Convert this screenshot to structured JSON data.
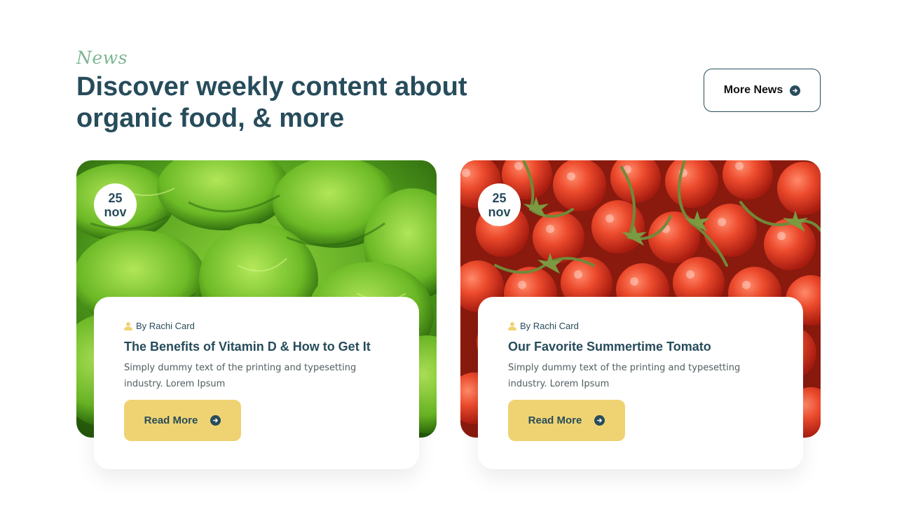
{
  "section": {
    "eyebrow": "News",
    "headline": "Discover weekly content about organic food, & more",
    "more_button": "More News"
  },
  "colors": {
    "primary": "#274c5b",
    "accent_green": "#7eb693",
    "button_yellow": "#efd372"
  },
  "cards": [
    {
      "date_day": "25",
      "date_month": "nov",
      "author": "By Rachi Card",
      "title": "The Benefits of Vitamin D & How to Get It",
      "excerpt": "Simply dummy text of the printing and typesetting industry. Lorem Ipsum",
      "button": "Read More",
      "image": "lettuce-photo"
    },
    {
      "date_day": "25",
      "date_month": "nov",
      "author": "By Rachi Card",
      "title": "Our Favorite Summertime Tomato",
      "excerpt": "Simply dummy text of the printing and typesetting industry. Lorem Ipsum",
      "button": "Read More",
      "image": "tomatoes-photo"
    }
  ],
  "icons": [
    "arrow-right-circle-icon",
    "user-icon"
  ]
}
